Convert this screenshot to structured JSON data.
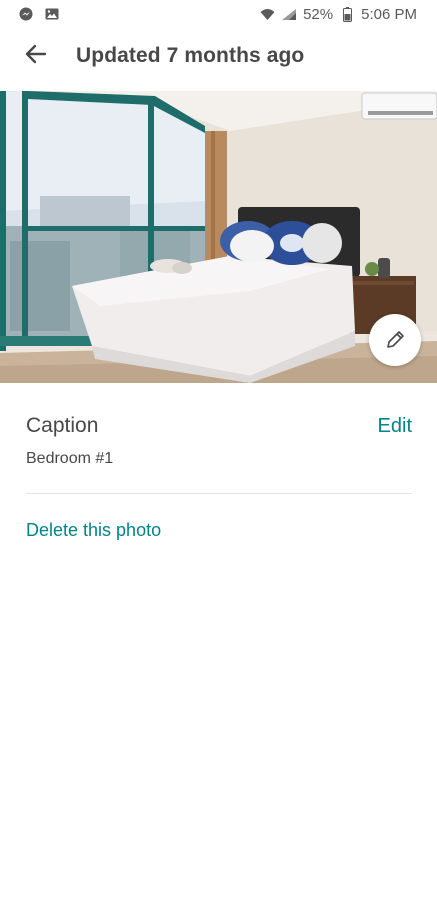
{
  "status_bar": {
    "battery": "52%",
    "time": "5:06 PM",
    "icons": [
      "messenger-icon",
      "gallery-icon",
      "wifi-icon",
      "signal-icon",
      "battery-icon"
    ]
  },
  "header": {
    "back_icon": "arrow-left-icon",
    "title": "Updated 7 months ago"
  },
  "photo": {
    "edit_icon": "pencil-icon"
  },
  "caption": {
    "label": "Caption",
    "edit_label": "Edit",
    "value": "Bedroom #1"
  },
  "actions": {
    "delete_label": "Delete this photo"
  },
  "colors": {
    "accent": "#008489",
    "text": "#484848",
    "divider": "#e4e4e4"
  }
}
